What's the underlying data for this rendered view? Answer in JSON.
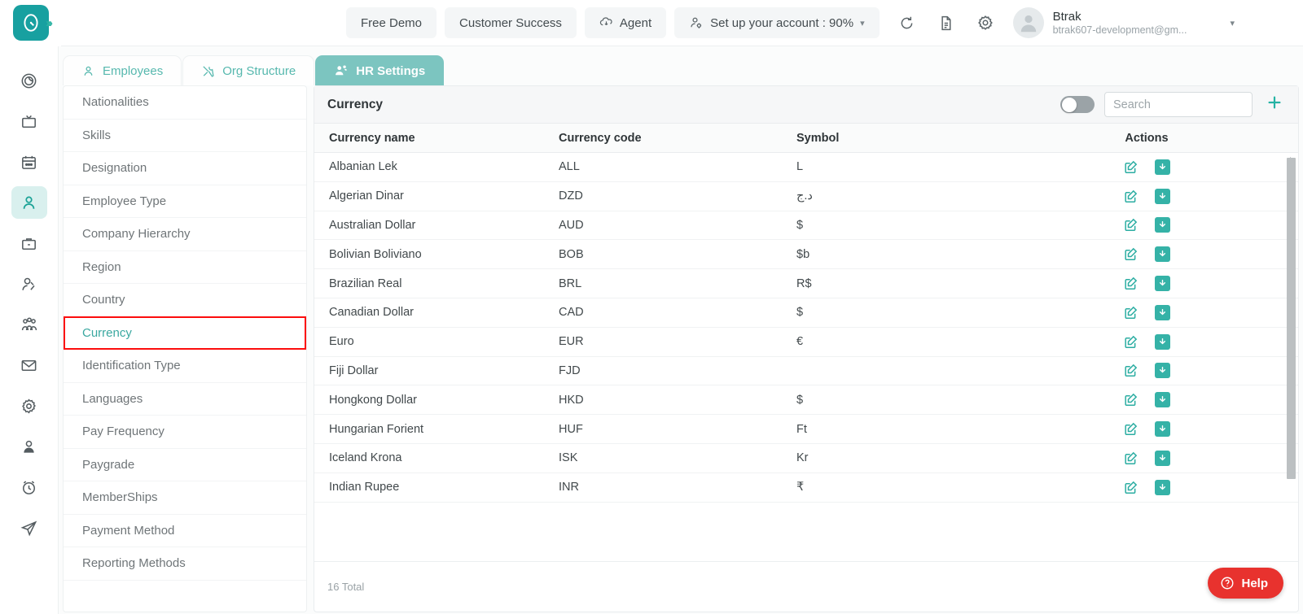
{
  "header": {
    "logo_icon": "clock-gauge-logo-icon",
    "expand_icon": "chevrons-right-icon",
    "chips": [
      {
        "label": "Free Demo",
        "icon": null
      },
      {
        "label": "Customer Success",
        "icon": null
      },
      {
        "label": "Agent",
        "icon": "cloud-download-icon"
      },
      {
        "label": "Set up your account : 90%",
        "icon": "user-gear-icon",
        "caret": "▾"
      }
    ],
    "icon_buttons": [
      {
        "name": "refresh-icon"
      },
      {
        "name": "document-icon"
      },
      {
        "name": "gear-icon"
      }
    ],
    "profile": {
      "name": "Btrak",
      "email": "btrak607-development@gm...",
      "avatar_icon": "user-avatar-icon",
      "caret": "▾"
    }
  },
  "rail": {
    "items": [
      {
        "name": "dashboard-spiral-icon",
        "active": false
      },
      {
        "name": "tv-screen-icon",
        "active": false
      },
      {
        "name": "calendar-icon",
        "active": false
      },
      {
        "name": "person-icon",
        "active": true
      },
      {
        "name": "briefcase-icon",
        "active": false
      },
      {
        "name": "user-add-icon",
        "active": false
      },
      {
        "name": "group-people-icon",
        "active": false
      },
      {
        "name": "mail-envelope-icon",
        "active": false
      },
      {
        "name": "settings-gear-icon",
        "active": false
      },
      {
        "name": "user-profile-icon",
        "active": false
      },
      {
        "name": "alarm-clock-icon",
        "active": false
      },
      {
        "name": "send-paper-plane-icon",
        "active": false
      }
    ]
  },
  "tabs": [
    {
      "label": "Employees",
      "icon": "person-outline-icon",
      "active": false
    },
    {
      "label": "Org Structure",
      "icon": "tools-icon",
      "active": false
    },
    {
      "label": "HR Settings",
      "icon": "people-gear-icon",
      "active": true
    }
  ],
  "sidebar": {
    "items": [
      {
        "label": "Nationalities",
        "active": false
      },
      {
        "label": "Skills",
        "active": false
      },
      {
        "label": "Designation",
        "active": false
      },
      {
        "label": "Employee Type",
        "active": false
      },
      {
        "label": "Company Hierarchy",
        "active": false
      },
      {
        "label": "Region",
        "active": false
      },
      {
        "label": "Country",
        "active": false
      },
      {
        "label": "Currency",
        "active": true
      },
      {
        "label": "Identification Type",
        "active": false
      },
      {
        "label": "Languages",
        "active": false
      },
      {
        "label": "Pay Frequency",
        "active": false
      },
      {
        "label": "Paygrade",
        "active": false
      },
      {
        "label": "MemberShips",
        "active": false
      },
      {
        "label": "Payment Method",
        "active": false
      },
      {
        "label": "Reporting Methods",
        "active": false
      }
    ],
    "highlight_index": 7,
    "highlight_color": "#fc0d0d"
  },
  "panel": {
    "title": "Currency",
    "toggle_on": false,
    "search_value": "",
    "search_placeholder": "Search",
    "add_icon": "plus-icon",
    "columns": [
      "Currency name",
      "Currency code",
      "Symbol",
      "Actions"
    ],
    "rows": [
      {
        "name": "Albanian Lek",
        "code": "ALL",
        "symbol": "L"
      },
      {
        "name": "Algerian Dinar",
        "code": "DZD",
        "symbol": "د.ج"
      },
      {
        "name": "Australian Dollar",
        "code": "AUD",
        "symbol": "$"
      },
      {
        "name": "Bolivian Boliviano",
        "code": "BOB",
        "symbol": "$b"
      },
      {
        "name": "Brazilian Real",
        "code": "BRL",
        "symbol": "R$"
      },
      {
        "name": "Canadian Dollar",
        "code": "CAD",
        "symbol": "$"
      },
      {
        "name": "Euro",
        "code": "EUR",
        "symbol": "€"
      },
      {
        "name": "Fiji Dollar",
        "code": "FJD",
        "symbol": ""
      },
      {
        "name": "Hongkong Dollar",
        "code": "HKD",
        "symbol": "$"
      },
      {
        "name": "Hungarian Forient",
        "code": "HUF",
        "symbol": "Ft"
      },
      {
        "name": "Iceland Krona",
        "code": "ISK",
        "symbol": "Kr"
      },
      {
        "name": "Indian Rupee",
        "code": "INR",
        "symbol": "₹"
      }
    ],
    "row_actions": [
      {
        "name": "edit-icon"
      },
      {
        "name": "download-icon"
      }
    ],
    "total_text": "16 Total"
  },
  "help": {
    "label": "Help",
    "icon": "question-circle-icon",
    "color": "#e8322e"
  },
  "theme": {
    "accent_teal": "#18a0a0",
    "tab_active": "#7cc5c0",
    "icon_teal": "#35b2a7",
    "help_red": "#e8322e"
  }
}
